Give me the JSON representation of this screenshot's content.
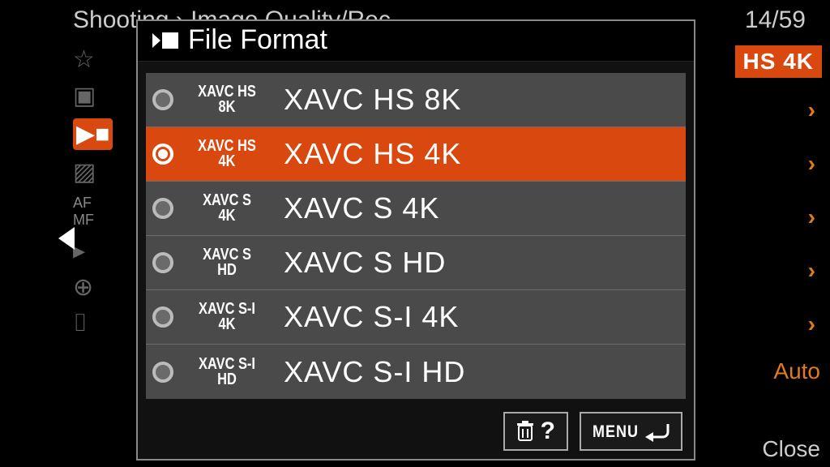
{
  "background": {
    "page_title": "Shooting › Image Quality/Rec",
    "page_count": "14/59",
    "badge": "HS 4K",
    "auto_text": "Auto",
    "close_text": "Close"
  },
  "modal": {
    "title": "File Format",
    "help_label": "?",
    "menu_label": "MENU"
  },
  "options": [
    {
      "icon_line1": "XAVC HS",
      "icon_line2": "8K",
      "label": "XAVC HS 8K",
      "selected": false
    },
    {
      "icon_line1": "XAVC HS",
      "icon_line2": "4K",
      "label": "XAVC HS 4K",
      "selected": true
    },
    {
      "icon_line1": "XAVC S",
      "icon_line2": "4K",
      "label": "XAVC S 4K",
      "selected": false
    },
    {
      "icon_line1": "XAVC S",
      "icon_line2": "HD",
      "label": "XAVC S HD",
      "selected": false
    },
    {
      "icon_line1": "XAVC S-I",
      "icon_line2": "4K",
      "label": "XAVC S-I 4K",
      "selected": false
    },
    {
      "icon_line1": "XAVC S-I",
      "icon_line2": "HD",
      "label": "XAVC S-I HD",
      "selected": false
    }
  ]
}
